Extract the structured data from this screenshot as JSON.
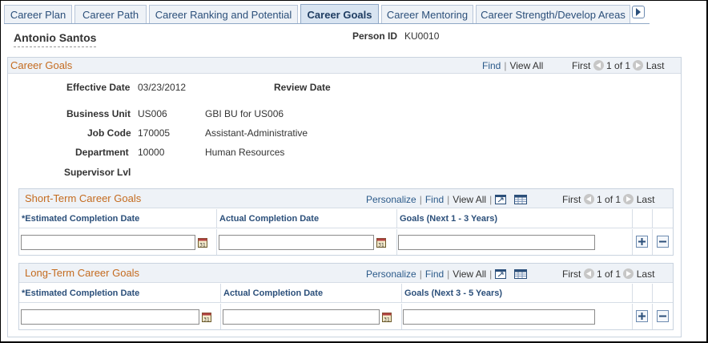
{
  "tabs": [
    {
      "label": "Career Plan",
      "active": false
    },
    {
      "label": "Career Path",
      "active": false
    },
    {
      "label": "Career Ranking and Potential",
      "active": false
    },
    {
      "label": "Career Goals",
      "active": true
    },
    {
      "label": "Career Mentoring",
      "active": false
    },
    {
      "label": "Career Strength/Develop Areas",
      "active": false
    }
  ],
  "person": {
    "name": "Antonio Santos",
    "id_label": "Person ID",
    "id_value": "KU0010"
  },
  "career_goals": {
    "title": "Career Goals",
    "find": "Find",
    "view_all": "View All",
    "first": "First",
    "counter": "1 of 1",
    "last": "Last",
    "effective_date_label": "Effective Date",
    "effective_date_value": "03/23/2012",
    "review_date_label": "Review Date",
    "business_unit_label": "Business Unit",
    "business_unit_code": "US006",
    "business_unit_desc": "GBI BU for US006",
    "job_code_label": "Job Code",
    "job_code_code": "170005",
    "job_code_desc": "Assistant-Administrative",
    "department_label": "Department",
    "department_code": "10000",
    "department_desc": "Human Resources",
    "supervisor_lvl_label": "Supervisor Lvl"
  },
  "short_term": {
    "title": "Short-Term Career Goals",
    "personalize": "Personalize",
    "find": "Find",
    "view_all": "View All",
    "first": "First",
    "counter": "1 of 1",
    "last": "Last",
    "col_est": "*Estimated Completion Date",
    "col_actual": "Actual Completion Date",
    "col_goals": "Goals (Next 1 - 3 Years)",
    "est_value": "",
    "actual_value": "",
    "goals_value": ""
  },
  "long_term": {
    "title": "Long-Term Career Goals",
    "personalize": "Personalize",
    "find": "Find",
    "view_all": "View All",
    "first": "First",
    "counter": "1 of 1",
    "last": "Last",
    "col_est": "*Estimated Completion Date",
    "col_actual": "Actual Completion Date",
    "col_goals": "Goals (Next 3 - 5 Years)",
    "est_value": "",
    "actual_value": "",
    "goals_value": ""
  },
  "icons": {
    "tab_scroll": "chevron-right-icon",
    "calendar": "calendar-icon",
    "zoom": "zoom-grid-icon",
    "download": "download-spreadsheet-icon",
    "add": "add-row-icon",
    "delete": "delete-row-icon",
    "prev": "previous-arrow-icon",
    "next": "next-arrow-icon"
  },
  "colors": {
    "group_title": "#c46b1f",
    "link": "#2b5a8a",
    "header_bg": "#eef2f7"
  }
}
